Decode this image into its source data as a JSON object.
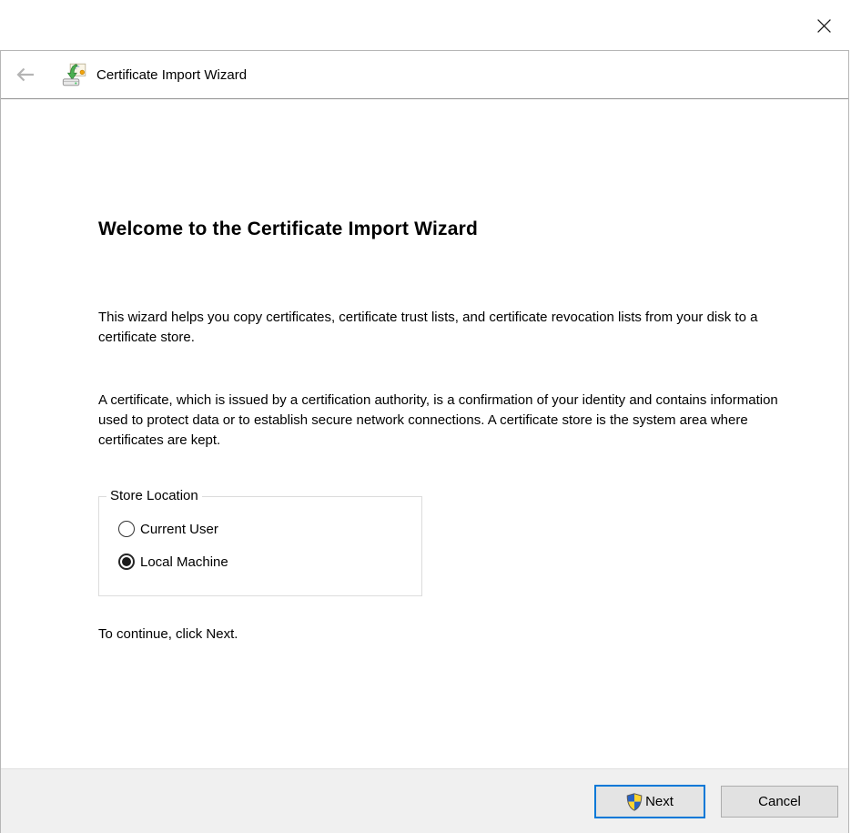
{
  "parent_window": {
    "close_icon": "close-x"
  },
  "header": {
    "title": "Certificate Import Wizard",
    "back_icon": "back-arrow",
    "app_icon": "certificate-import"
  },
  "content": {
    "heading": "Welcome to the Certificate Import Wizard",
    "para1": "This wizard helps you copy certificates, certificate trust lists, and certificate revocation lists from your disk to a certificate store.",
    "para2": "A certificate, which is issued by a certification authority, is a confirmation of your identity and contains information used to protect data or to establish secure network connections. A certificate store is the system area where certificates are kept.",
    "store_location": {
      "label": "Store Location",
      "options": [
        {
          "label": "Current User",
          "selected": false
        },
        {
          "label": "Local Machine",
          "selected": true
        }
      ]
    },
    "continue_text": "To continue, click Next."
  },
  "footer": {
    "next_label": "Next",
    "next_icon": "uac-shield",
    "cancel_label": "Cancel"
  },
  "colors": {
    "accent": "#0078d7",
    "footer_bg": "#f0f0f0",
    "button_bg": "#e1e1e1",
    "button_border": "#adadad",
    "window_border": "#b6b6b6",
    "header_divider": "#8f8f8f",
    "groupbox_border": "#dcdcdc",
    "shield_blue": "#2862c4",
    "shield_yellow": "#fed42e"
  }
}
